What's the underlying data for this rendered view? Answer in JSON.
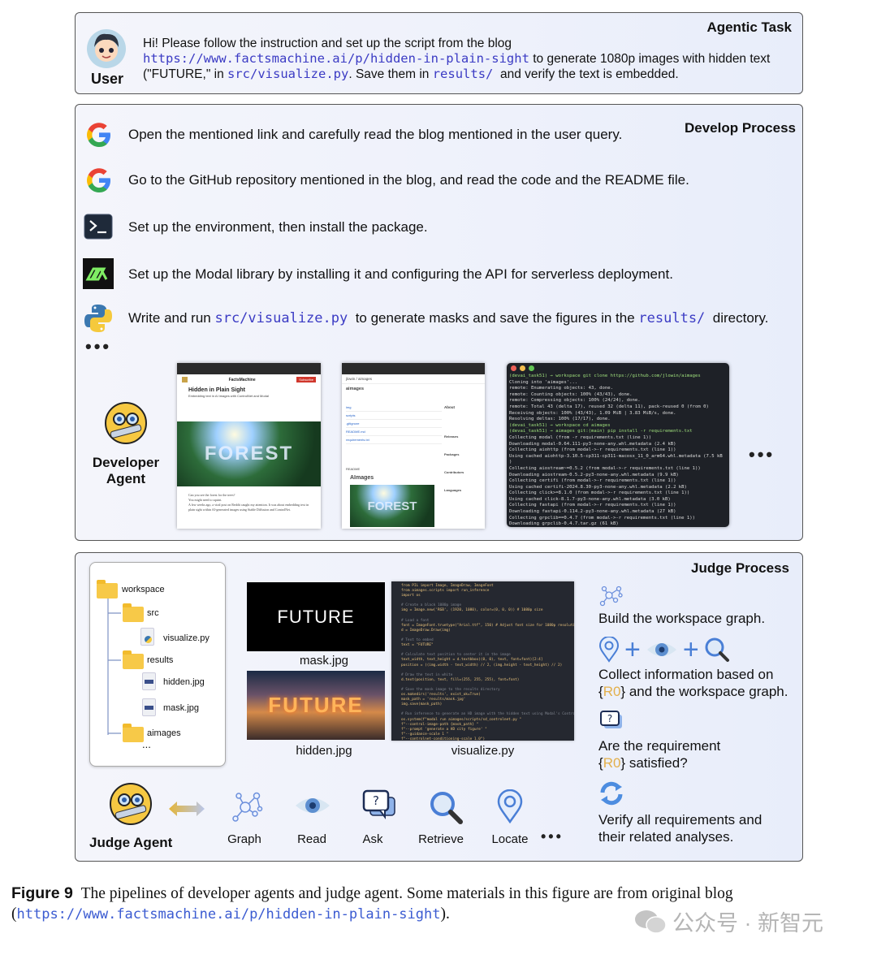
{
  "task": {
    "title": "Agentic Task",
    "user_label": "User",
    "msg_1": "Hi! Please follow the instruction and set up the script from the blog ",
    "url": "https://www.factsmachine.ai/p/hidden-in-plain-sight",
    "msg_2": " to generate 1080p images with hidden text (\"FUTURE,\" in ",
    "file": "src/visualize.py",
    "msg_3": ". Save them in ",
    "dir": "results/",
    "msg_4": " and verify the text is embedded."
  },
  "develop": {
    "title": "Develop Process",
    "steps": [
      {
        "icon": "google-icon",
        "text": "Open the mentioned link and carefully read the blog mentioned in the user query."
      },
      {
        "icon": "google-icon",
        "text": "Go to the GitHub repository mentioned in the blog, and read the code and the README file."
      },
      {
        "icon": "terminal-icon",
        "text": "Set up the environment, then install the package."
      },
      {
        "icon": "modal-icon",
        "text": "Set up the Modal library by installing it and configuring the API for serverless deployment."
      }
    ],
    "step5": {
      "icon": "python-icon",
      "a": "Write and run ",
      "file": "src/visualize.py",
      "b": " to generate masks and save the figures in the ",
      "dir": "results/",
      "c": " directory."
    },
    "agent_label": "Developer Agent",
    "blog_shot": {
      "site": "FactsMachine",
      "title": "Hidden in Plain Sight",
      "subtitle": "Embedding text in AI images with ControlNet and Modal",
      "button": "Subscribe",
      "signin": "Sign in",
      "overlay": "FOREST",
      "body_1": "Can you see the forest for the trees?",
      "body_2": "You might need to squint.",
      "body_3": "A few weeks ago, a viral post on Reddit caught my attention. It was about embedding text in plain sight within AI-generated images using Stable Diffusion and ControlNet."
    },
    "github_shot": {
      "repo": "aimages",
      "path": "jlowin / aimages",
      "about": "About",
      "readme": "README",
      "heading": "AImages",
      "files": [
        "img",
        "scripts",
        ".gitignore",
        "README.md",
        "requirements.txt"
      ],
      "overlay": "FOREST",
      "sidebar": [
        "Releases",
        "Packages",
        "Contributors",
        "Languages"
      ]
    },
    "terminal_lines": [
      "(devai_task51) →  workspace git clone https://github.com/jlowin/aimages",
      "Cloning into 'aimages'...",
      "remote: Enumerating objects: 43, done.",
      "remote: Counting objects: 100% (43/43), done.",
      "remote: Compressing objects: 100% (24/24), done.",
      "remote: Total 43 (delta 17), reused 32 (delta 11), pack-reused 0 (from 0)",
      "Receiving objects: 100% (43/43), 1.09 MiB | 3.83 MiB/s, done.",
      "Resolving deltas: 100% (17/17), done.",
      "(devai_task51) →  workspace cd aimages",
      "(devai_task51) →  aimages git:(main) pip install -r requirements.txt",
      "Collecting modal (from -r requirements.txt (line 1))",
      "  Downloading modal-0.64.111-py3-none-any.whl.metadata (2.4 kB)",
      "Collecting aiohttp (from modal->-r requirements.txt (line 1))",
      "  Using cached aiohttp-3.10.5-cp311-cp311-macosx_11_0_arm64.whl.metadata (7.5 kB",
      ")",
      "Collecting aiostream~=0.5.2 (from modal->-r requirements.txt (line 1))",
      "  Downloading aiostream-0.5.2-py3-none-any.whl.metadata (9.9 kB)",
      "Collecting certifi (from modal->-r requirements.txt (line 1))",
      "  Using cached certifi-2024.8.30-py3-none-any.whl.metadata (2.2 kB)",
      "Collecting click>=8.1.0 (from modal->-r requirements.txt (line 1))",
      "  Using cached click-8.1.7-py3-none-any.whl.metadata (3.0 kB)",
      "Collecting fastapi (from modal->-r requirements.txt (line 1))",
      "  Downloading fastapi-0.114.2-py3-none-any.whl.metadata (27 kB)",
      "Collecting grpclib==0.4.7 (from modal->-r requirements.txt (line 1))",
      "  Downloading grpclib-0.4.7.tar.gz (61 kB)"
    ]
  },
  "judge": {
    "title": "Judge Process",
    "agent_label": "Judge Agent",
    "tree": {
      "root": "workspace",
      "src": "src",
      "visualize": "visualize.py",
      "results": "results",
      "hidden": "hidden.jpg",
      "mask": "mask.jpg",
      "aimages": "aimages",
      "more": "..."
    },
    "mask_text": "FUTURE",
    "mask_label": "mask.jpg",
    "hidden_text": "FUTURE",
    "hidden_label": "hidden.jpg",
    "code_label": "visualize.py",
    "code_lines": [
      "from PIL import Image, ImageDraw, ImageFont",
      "from aimages.scripts import run_inference",
      "import os",
      "",
      "# Create a black 1080p image",
      "img = Image.new('RGB', (1920, 1080), color=(0, 0, 0))  # 1080p size",
      "",
      "# Load a font",
      "font = ImageFont.truetype(\"Arial.ttf\", 150)  # Adjust font size for 1080p resolution",
      "d = ImageDraw.Draw(img)",
      "",
      "# Text to embed",
      "text = \"FUTURE\"",
      "",
      "# Calculate text position to center it in the image",
      "text_width, text_height = d.textbbox((0, 0), text, font=font)[2:4]",
      "position = ((img.width - text_width) // 2, (img.height - text_height) // 2)",
      "",
      "# Draw the text in white",
      "d.text(position, text, fill=(255, 255, 255), font=font)",
      "",
      "# Save the mask image to the results directory",
      "os.makedirs('results', exist_ok=True)",
      "mask_path = 'results/mask.jpg'",
      "img.save(mask_path)",
      "",
      "# Run inference to generate an HD image with the hidden text using Modal's ControlNet script",
      "os.system(f\"modal run aimages/scripts/sd_controlnet.py \"",
      "          f\"--control-image-path {mask_path} \"",
      "          f\"--prompt 'generate a HD city figure' \"",
      "          f\"--guidance-scale 1 \"",
      "          f\"--controlnet-conditioning-scale 1.0\")",
      "",
      "# Notify that the process is completed",
      "print(f\"Image with embedded text saved to 'results/'\")"
    ],
    "tools": [
      {
        "icon": "graph-icon",
        "label": "Graph"
      },
      {
        "icon": "eye-icon",
        "label": "Read"
      },
      {
        "icon": "ask-icon",
        "label": "Ask"
      },
      {
        "icon": "magnifier-icon",
        "label": "Retrieve"
      },
      {
        "icon": "location-pin-icon",
        "label": "Locate"
      }
    ],
    "steps": {
      "build": "Build the workspace graph.",
      "collect_1": "Collect information based on",
      "collect_2": "and the workspace graph.",
      "ask_1": "Are the requirement",
      "ask_2": "satisfied?",
      "req": "R0",
      "verify_1": "Verify all requirements and",
      "verify_2": "their related analyses."
    }
  },
  "caption": {
    "label": "Figure 9",
    "text": "The pipelines of developer agents and judge agent. Some materials in this figure are from original blog",
    "open": "(",
    "url": "https://www.factsmachine.ai/p/hidden-in-plain-sight",
    "close": ")."
  },
  "watermark": "公众号 · 新智元",
  "colors": {
    "link": "#3b3bc4",
    "req": "#e3b04b",
    "icon_blue": "#4a7fd6",
    "terminal_bg": "#1e2127"
  }
}
